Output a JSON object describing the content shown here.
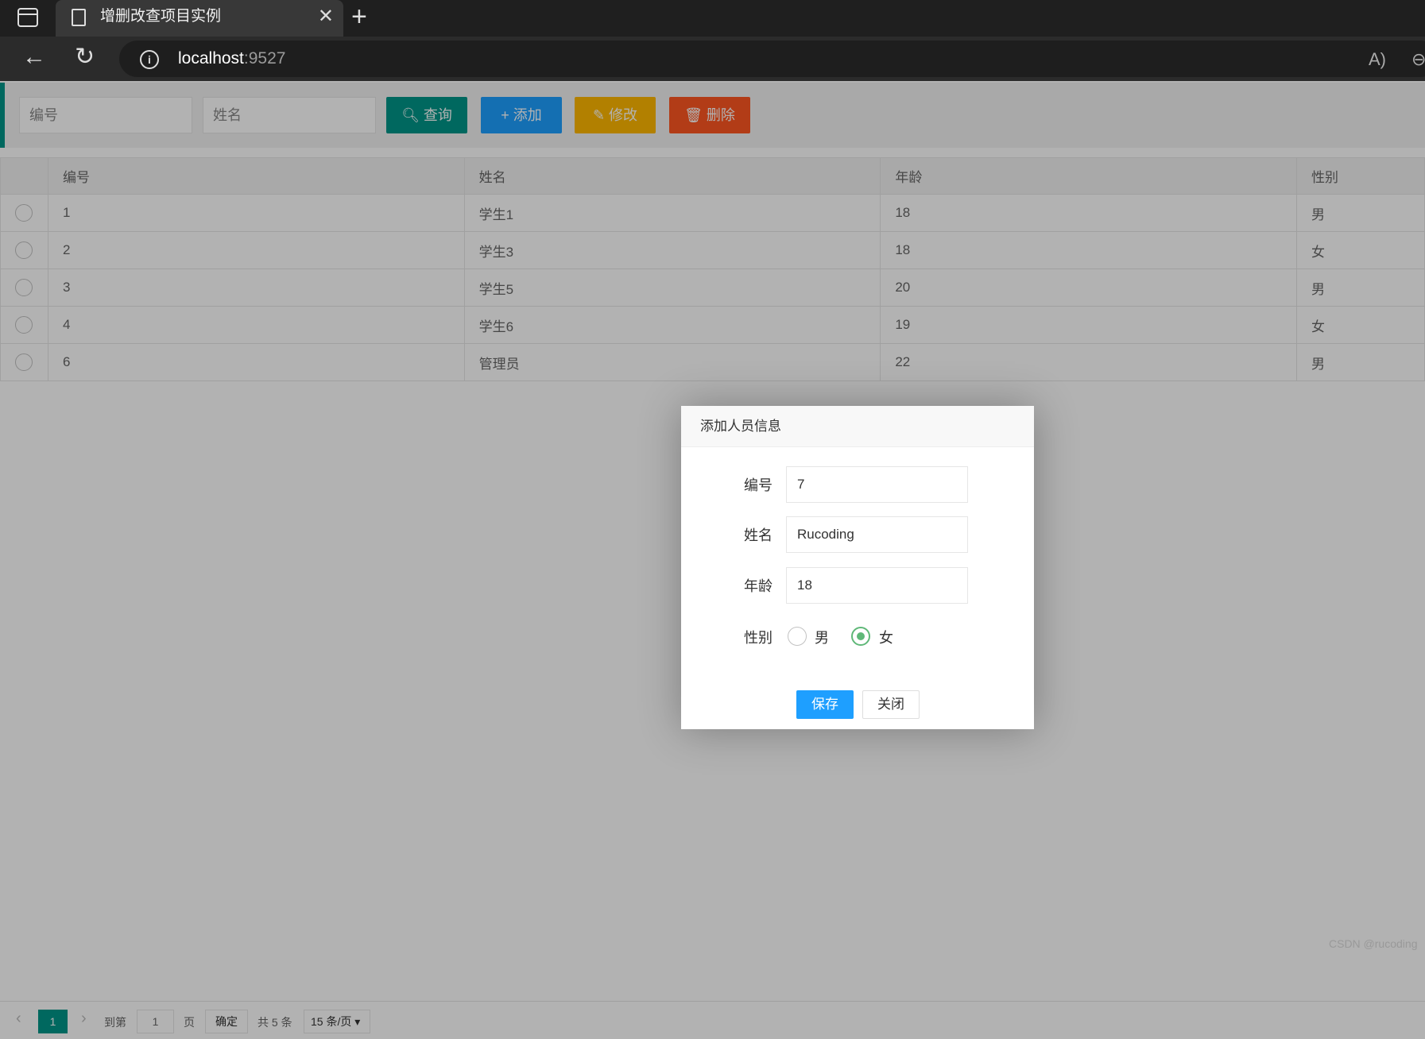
{
  "browser": {
    "tab_title": "增删改查项目实例",
    "url_host": "localhost",
    "url_port": ":9527",
    "read_aloud_glyph": "A)"
  },
  "toolbar": {
    "id_placeholder": "编号",
    "name_placeholder": "姓名",
    "search_label": "查询",
    "add_label": "添加",
    "edit_label": "修改",
    "delete_label": "删除",
    "colors": {
      "search": "#009688",
      "add": "#1e9fff",
      "edit": "#ffb800",
      "delete": "#ff5722"
    }
  },
  "table": {
    "headers": [
      "编号",
      "姓名",
      "年龄",
      "性别"
    ],
    "rows": [
      {
        "id": "1",
        "name": "学生1",
        "age": "18",
        "gender": "男"
      },
      {
        "id": "2",
        "name": "学生3",
        "age": "18",
        "gender": "女"
      },
      {
        "id": "3",
        "name": "学生5",
        "age": "20",
        "gender": "男"
      },
      {
        "id": "4",
        "name": "学生6",
        "age": "19",
        "gender": "女"
      },
      {
        "id": "6",
        "name": "管理员",
        "age": "22",
        "gender": "男"
      }
    ]
  },
  "pager": {
    "current_page": "1",
    "goto_label": "到第",
    "goto_value": "1",
    "page_unit": "页",
    "confirm_label": "确定",
    "total_label": "共 5 条",
    "limit_label": "15 条/页"
  },
  "dialog": {
    "title": "添加人员信息",
    "id_label": "编号",
    "id_value": "7",
    "name_label": "姓名",
    "name_value": "Rucoding",
    "age_label": "年龄",
    "age_value": "18",
    "gender_label": "性别",
    "gender_options": [
      "男",
      "女"
    ],
    "gender_selected": "女",
    "save_label": "保存",
    "close_label": "关闭"
  },
  "watermark": "CSDN @rucoding"
}
